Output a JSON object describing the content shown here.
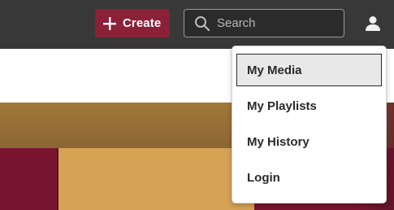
{
  "header": {
    "create_label": "Create",
    "search_placeholder": "Search",
    "search_icon": "search-icon",
    "user_icon": "user-icon"
  },
  "user_menu": {
    "items": [
      {
        "label": "My Media",
        "active": true
      },
      {
        "label": "My Playlists",
        "active": false
      },
      {
        "label": "My History",
        "active": false
      },
      {
        "label": "Login",
        "active": false
      }
    ]
  },
  "colors": {
    "header_bg": "#383838",
    "create_button": "#8a2139",
    "maroon": "#7a1530",
    "gold": "#d6a254"
  }
}
